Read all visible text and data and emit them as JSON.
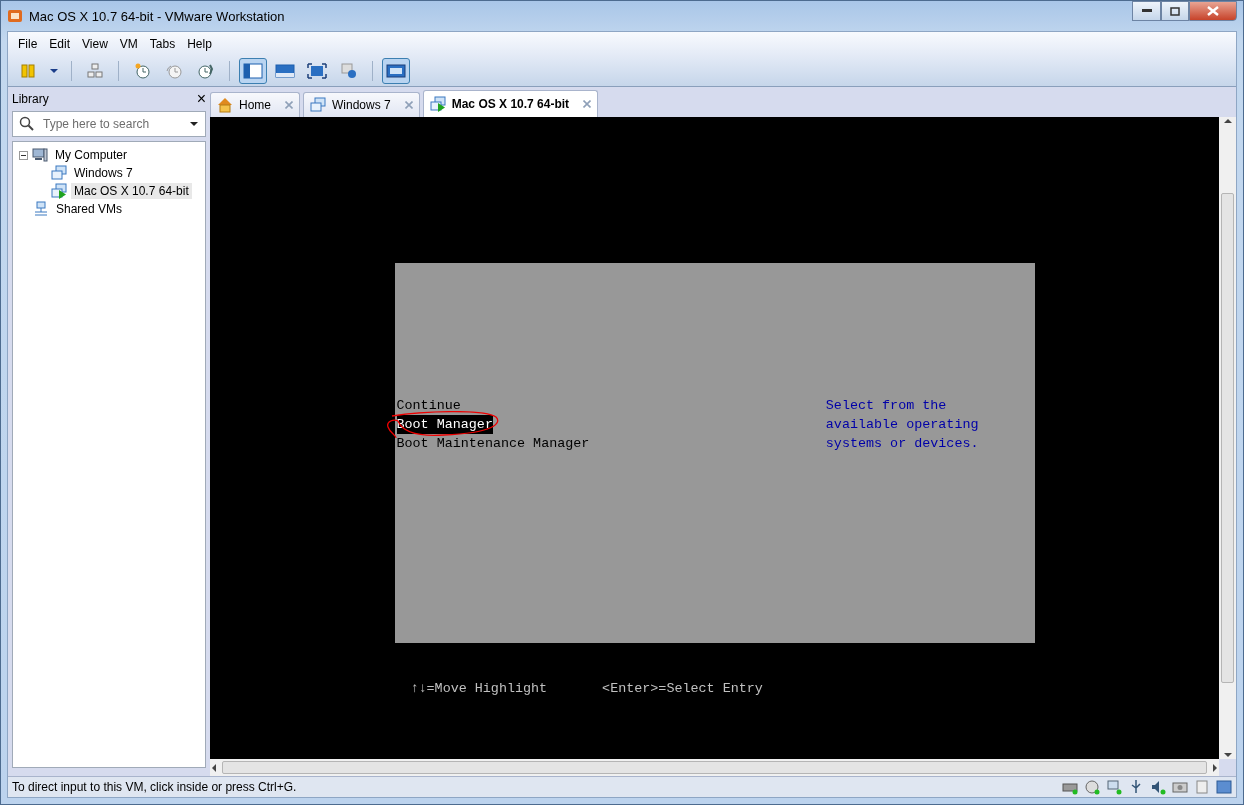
{
  "window": {
    "title": "Mac OS X 10.7 64-bit - VMware Workstation"
  },
  "menu": [
    "File",
    "Edit",
    "View",
    "VM",
    "Tabs",
    "Help"
  ],
  "toolbar": [
    {
      "kind": "pause",
      "selected": false
    },
    {
      "kind": "dropdown",
      "selected": false
    },
    {
      "kind": "sep"
    },
    {
      "kind": "network",
      "selected": false
    },
    {
      "kind": "sep"
    },
    {
      "kind": "snapshot",
      "selected": false
    },
    {
      "kind": "revert",
      "selected": false
    },
    {
      "kind": "manager",
      "selected": false
    },
    {
      "kind": "sep"
    },
    {
      "kind": "sidebar",
      "selected": true
    },
    {
      "kind": "console",
      "selected": false
    },
    {
      "kind": "fullscreen",
      "selected": false
    },
    {
      "kind": "unity",
      "selected": false
    },
    {
      "kind": "sep"
    },
    {
      "kind": "thumbnail",
      "selected": true
    }
  ],
  "library": {
    "title": "Library",
    "close": "×",
    "search": {
      "placeholder": "Type here to search"
    },
    "tree": [
      {
        "label": "My Computer",
        "kind": "computer",
        "expanded": true,
        "selected": false,
        "children": [
          {
            "label": "Windows 7",
            "kind": "vm",
            "selected": false
          },
          {
            "label": "Mac OS X 10.7 64-bit",
            "kind": "vm-running",
            "selected": true
          }
        ]
      },
      {
        "label": "Shared VMs",
        "kind": "shared",
        "selected": false
      }
    ]
  },
  "tabs": [
    {
      "label": "Home",
      "kind": "home",
      "selected": false
    },
    {
      "label": "Windows 7",
      "kind": "vm",
      "selected": false
    },
    {
      "label": "Mac OS X 10.7 64-bit",
      "kind": "vm-running",
      "selected": true
    }
  ],
  "boot_menu": {
    "items": [
      {
        "label": "Continue",
        "selected": false
      },
      {
        "label": "Boot Manager",
        "selected": true
      },
      {
        "label": "Boot Maintenance Manager",
        "selected": false
      }
    ],
    "help": [
      "Select from the",
      "available operating",
      "systems or devices."
    ],
    "hints": [
      "↑↓=Move Highlight",
      "<Enter>=Select Entry"
    ]
  },
  "status_bar": {
    "text": "To direct input to this VM, click inside or press Ctrl+G."
  }
}
